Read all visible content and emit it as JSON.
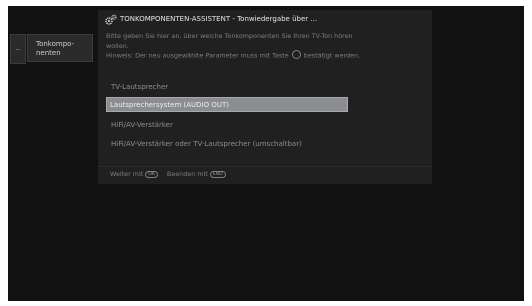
{
  "tabs": {
    "small": "..",
    "main_line1": "Tonkompo-",
    "main_line2": "nenten"
  },
  "dialog": {
    "title": "TONKOMPONENTEN-ASSISTENT - Tonwiedergabe über ...",
    "description_line1": "Bitte geben Sie hier an, über welche Tonkomponenten Sie Ihren TV-Ton hören",
    "description_line2": "wollen.",
    "hint_before": "Hinweis: Der neu ausgewählte Parameter muss mit Taste",
    "hint_after": "bestätigt werden.",
    "options": [
      "TV-Lautsprecher",
      "Lautsprechersystem (AUDIO OUT)",
      "HiFi/AV-Verstärker",
      "HiFi/AV-Verstärker oder TV-Lautsprecher (umschaltbar)"
    ],
    "selected_index": 1
  },
  "footer": {
    "continue_label": "Weiter mit",
    "continue_key": "OK",
    "exit_label": "Beenden mit",
    "exit_key": "END"
  },
  "colors": {
    "background": "#111112",
    "dialog": "#202021",
    "selected": "#8b8d91"
  },
  "icons": {
    "header": "gears-icon",
    "ok": "ok-circle-icon"
  }
}
